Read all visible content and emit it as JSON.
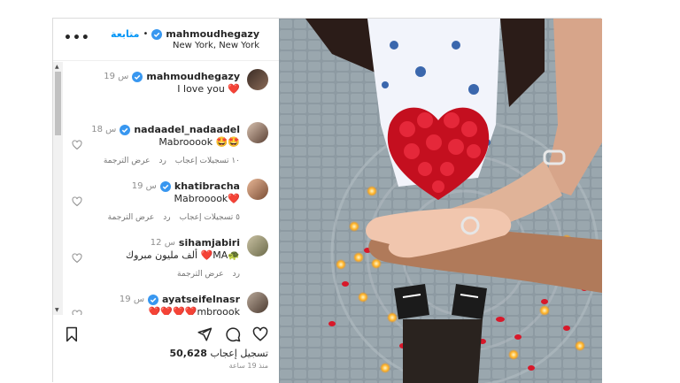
{
  "colors": {
    "link": "#0095f6",
    "verified": "#3897f0",
    "heart": "#e01b2b",
    "muted": "#8e8e8e"
  },
  "header": {
    "username": "mahmoudhegazy",
    "follow_label": "متابعة",
    "separator": "•",
    "location": "New York, New York",
    "more_label": "•••"
  },
  "comments": [
    {
      "user": "mahmoudhegazy",
      "time": "19 س",
      "text": "I love you ❤️",
      "verified": true,
      "meta": [],
      "likeable": false
    },
    {
      "user": "nadaadel_nadaadel",
      "time": "18 س",
      "text": "Mabrooook 🤩🤩",
      "verified": true,
      "meta": [
        "١٠ تسجيلات إعجاب",
        "رد",
        "عرض الترجمة"
      ],
      "likeable": true
    },
    {
      "user": "khatibracha",
      "time": "19 س",
      "text": "Mabrooook❤️",
      "verified": true,
      "meta": [
        "٥ تسجيلات إعجاب",
        "رد",
        "عرض الترجمة"
      ],
      "likeable": true
    },
    {
      "user": "sihamjabiri",
      "time": "12 س",
      "text": "ألف مليون مبروك ❤️MA🐢",
      "verified": false,
      "meta": [
        "رد",
        "عرض الترجمة"
      ],
      "likeable": true
    },
    {
      "user": "ayatseifelnasr",
      "time": "19 س",
      "text": "❤️❤️❤️❤️mbroook",
      "verified": true,
      "meta": [],
      "likeable": true
    }
  ],
  "post": {
    "likes_number": "50,628",
    "likes_label": "تسجيل إعجاب",
    "posted_ago": "منذ 19 ساعة"
  },
  "icons": {
    "save": "bookmark-icon",
    "share": "send-icon",
    "comment": "comment-icon",
    "like": "heart-icon"
  }
}
